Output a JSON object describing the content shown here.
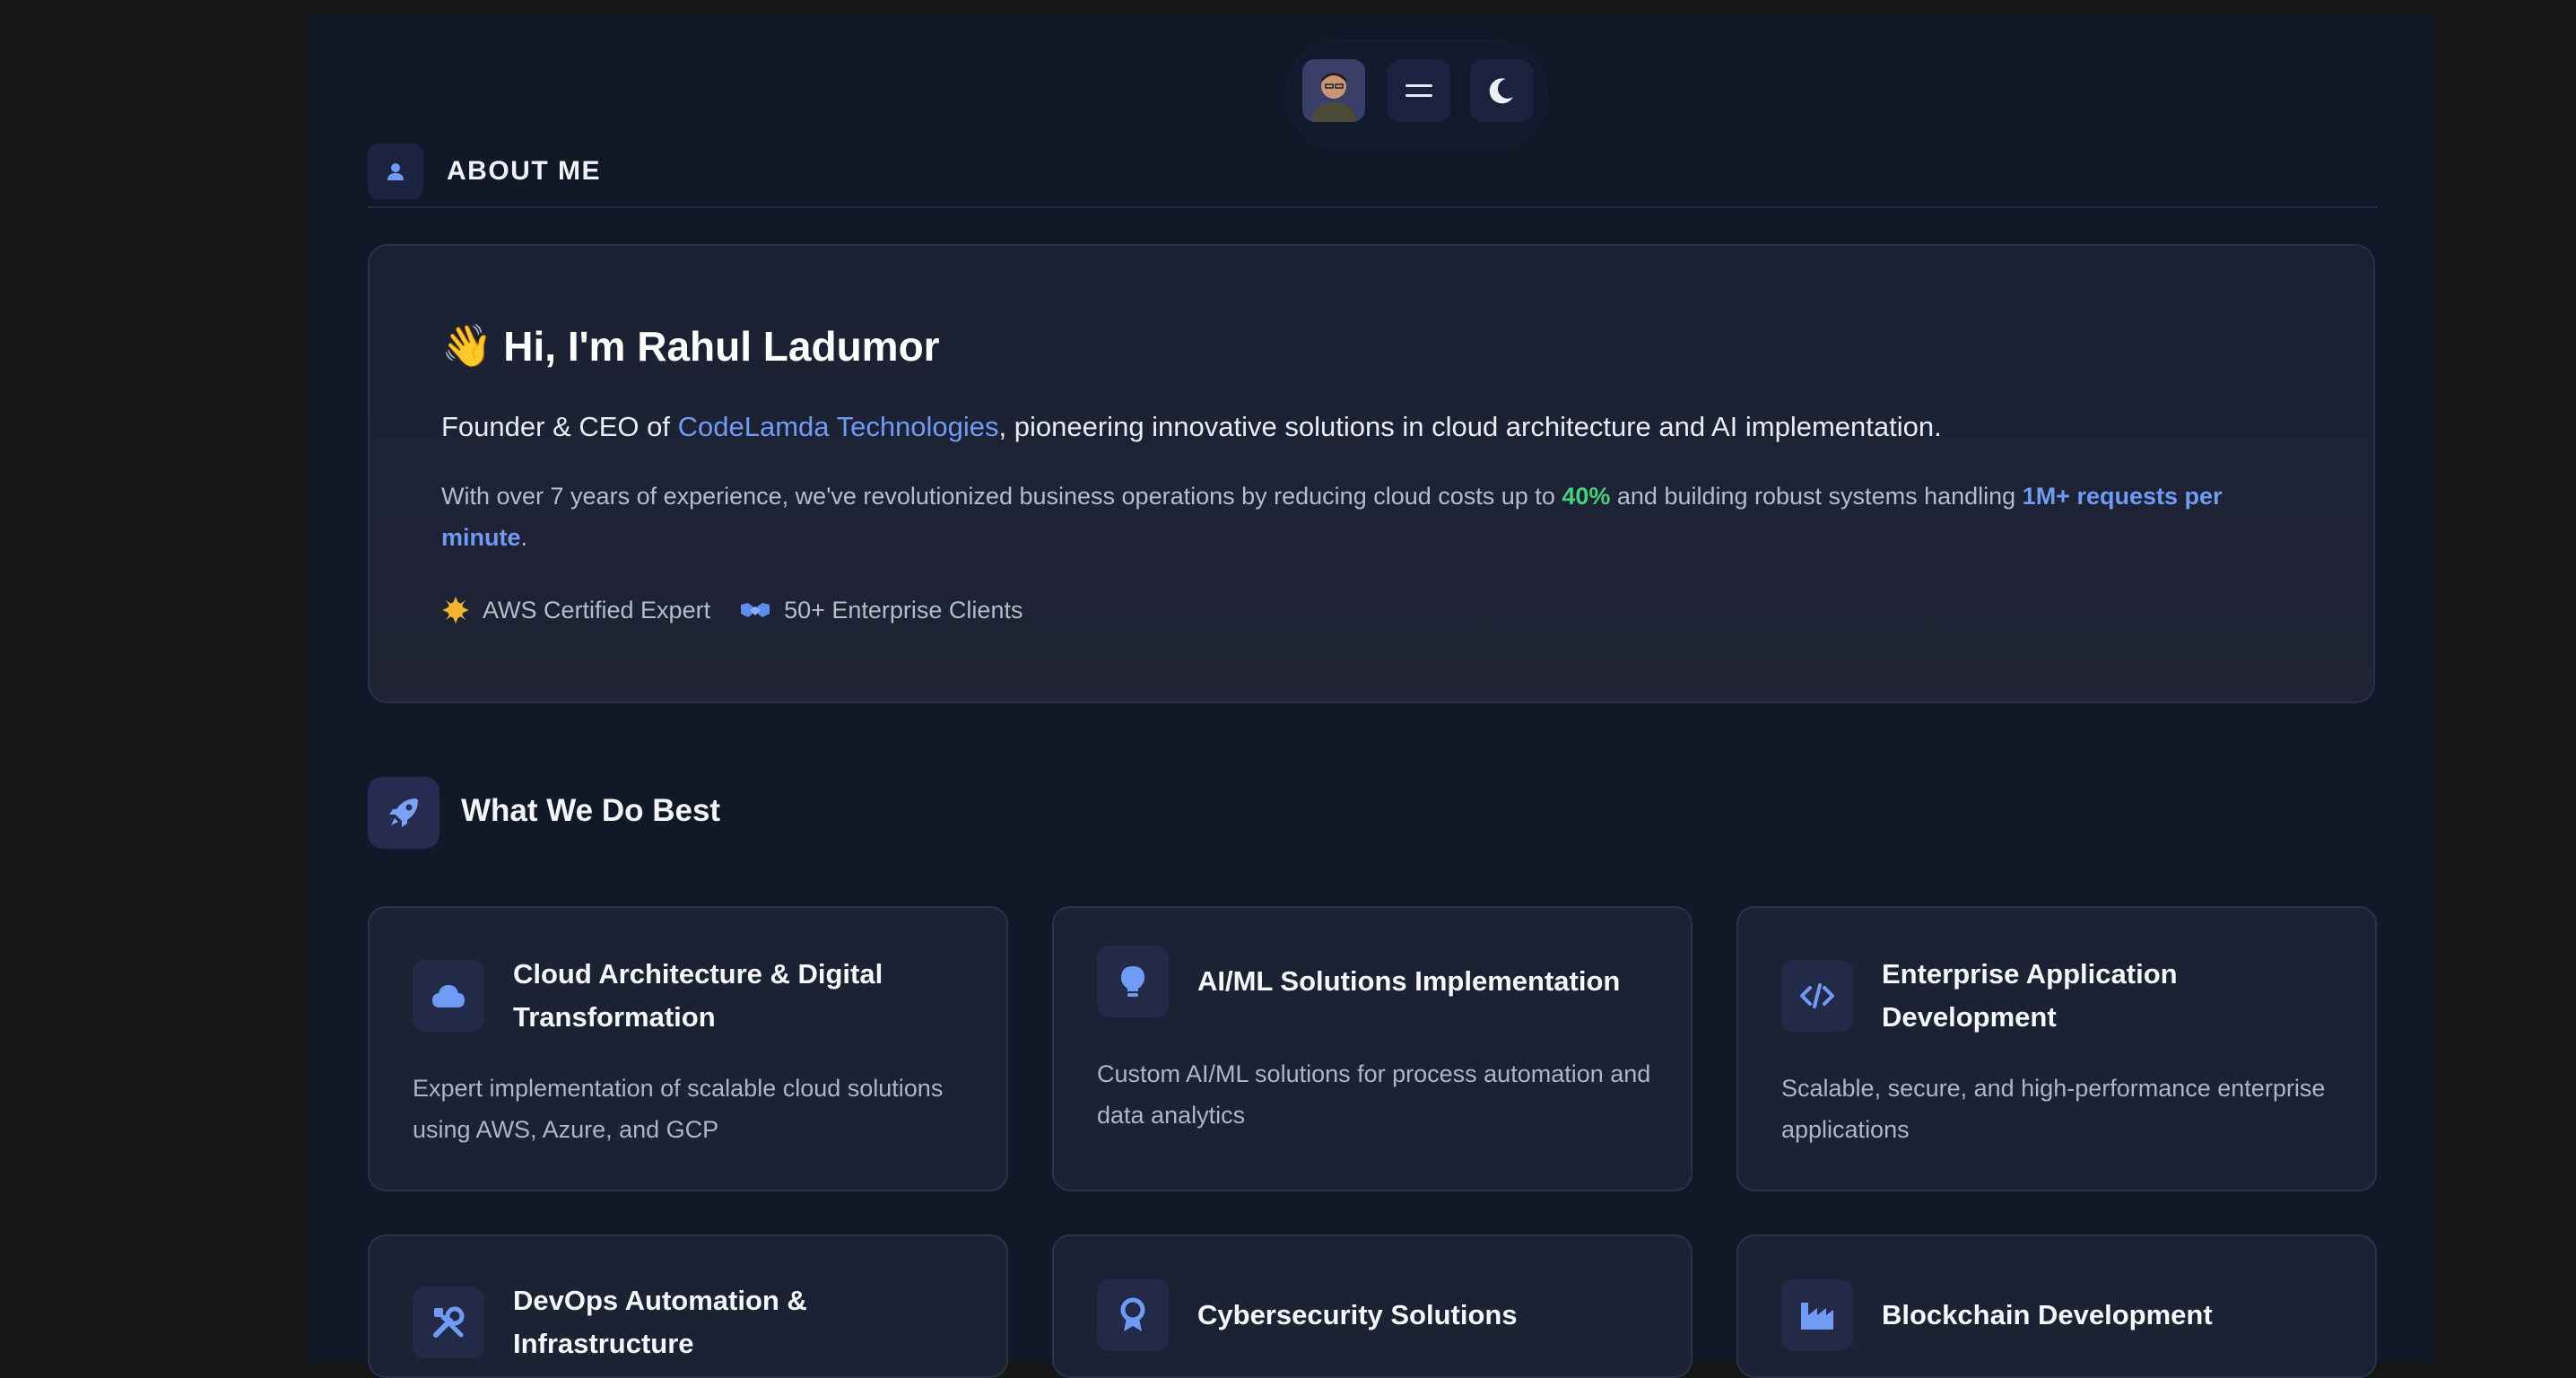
{
  "nav": {
    "avatar_icon": "avatar-icon",
    "menu_icon": "menu-icon",
    "theme_icon": "moon-icon"
  },
  "about": {
    "title": "ABOUT ME",
    "icon": "user-icon"
  },
  "intro": {
    "greeting_emoji": "👋",
    "greeting": "Hi, I'm Rahul Ladumor",
    "lead_prefix": "Founder & CEO of ",
    "lead_link": "CodeLamda Technologies",
    "lead_suffix": ", pioneering innovative solutions in cloud architecture and AI implementation.",
    "detail_1": "With over 7 years of experience, we've revolutionized business operations by reducing cloud costs up to ",
    "detail_highlight_green": "40%",
    "detail_2": " and building robust systems handling ",
    "detail_highlight_blue": "1M+ requests per minute",
    "detail_3": ".",
    "badges": [
      {
        "icon": "sun-badge-icon",
        "label": "AWS Certified Expert"
      },
      {
        "icon": "handshake-icon",
        "label": "50+ Enterprise Clients"
      }
    ]
  },
  "services": {
    "title": "What We Do Best",
    "icon": "rocket-icon",
    "items": [
      {
        "icon": "cloud-icon",
        "title": "Cloud Architecture & Digital Transformation",
        "desc": "Expert implementation of scalable cloud solutions using AWS, Azure, and GCP"
      },
      {
        "icon": "lightbulb-icon",
        "title": "AI/ML Solutions Implementation",
        "desc": "Custom AI/ML solutions for process automation and data analytics"
      },
      {
        "icon": "code-icon",
        "title": "Enterprise Application Development",
        "desc": "Scalable, secure, and high-performance enterprise applications"
      },
      {
        "icon": "tools-icon",
        "title": "DevOps Automation & Infrastructure",
        "desc": ""
      },
      {
        "icon": "award-icon",
        "title": "Cybersecurity Solutions",
        "desc": ""
      },
      {
        "icon": "industry-icon",
        "title": "Blockchain Development",
        "desc": ""
      }
    ]
  },
  "colors": {
    "accent_blue": "#6f9bf5",
    "accent_green": "#45d27a",
    "background": "#111827"
  }
}
